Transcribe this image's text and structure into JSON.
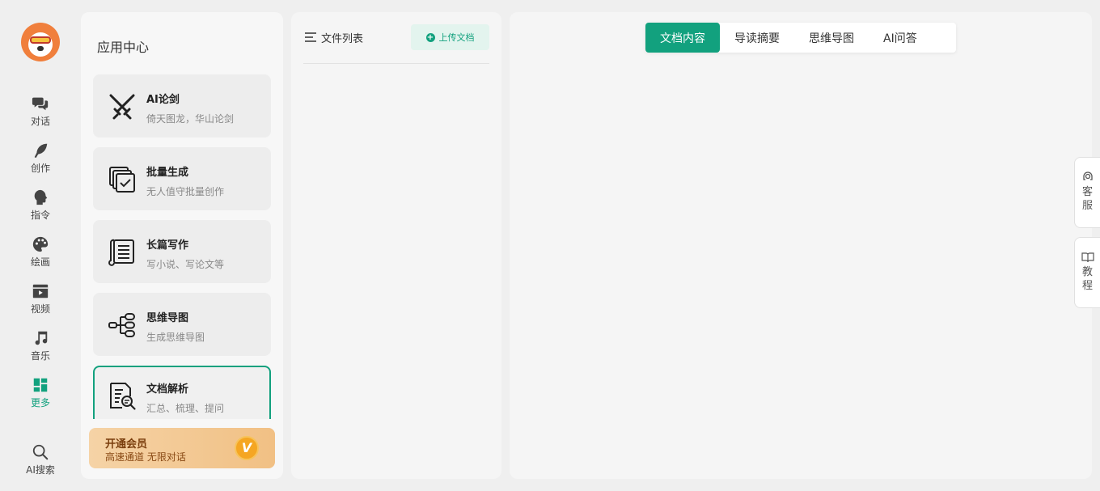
{
  "nav": {
    "items": [
      {
        "label": "对话"
      },
      {
        "label": "创作"
      },
      {
        "label": "指令"
      },
      {
        "label": "绘画"
      },
      {
        "label": "视频"
      },
      {
        "label": "音乐"
      },
      {
        "label": "更多"
      }
    ],
    "search": {
      "label": "AI搜索"
    },
    "active_color": "#12a17e"
  },
  "apps": {
    "title": "应用中心",
    "cards": [
      {
        "title": "AI论剑",
        "desc": "倚天图龙，华山论剑",
        "icon": "crossed-swords-icon"
      },
      {
        "title": "批量生成",
        "desc": "无人值守批量创作",
        "icon": "batch-copy-icon"
      },
      {
        "title": "长篇写作",
        "desc": "写小说、写论文等",
        "icon": "scroll-document-icon"
      },
      {
        "title": "思维导图",
        "desc": "生成思维导图",
        "icon": "mindmap-icon"
      },
      {
        "title": "文档解析",
        "desc": "汇总、梳理、提问",
        "icon": "document-search-icon",
        "active": true
      }
    ],
    "vip": {
      "title": "开通会员",
      "desc": "高速通道 无限对话",
      "badge": "V"
    }
  },
  "files": {
    "title": "文件列表",
    "upload_label": "上传文档"
  },
  "content": {
    "tabs": [
      {
        "label": "文档内容",
        "active": true
      },
      {
        "label": "导读摘要"
      },
      {
        "label": "思维导图"
      },
      {
        "label": "AI问答"
      }
    ]
  },
  "side": {
    "service_label": "客服",
    "tutorial_label": "教程"
  },
  "colors": {
    "accent": "#12a17e",
    "vip_gradient_start": "#f5d3a6",
    "vip_gradient_end": "#f1c084"
  }
}
